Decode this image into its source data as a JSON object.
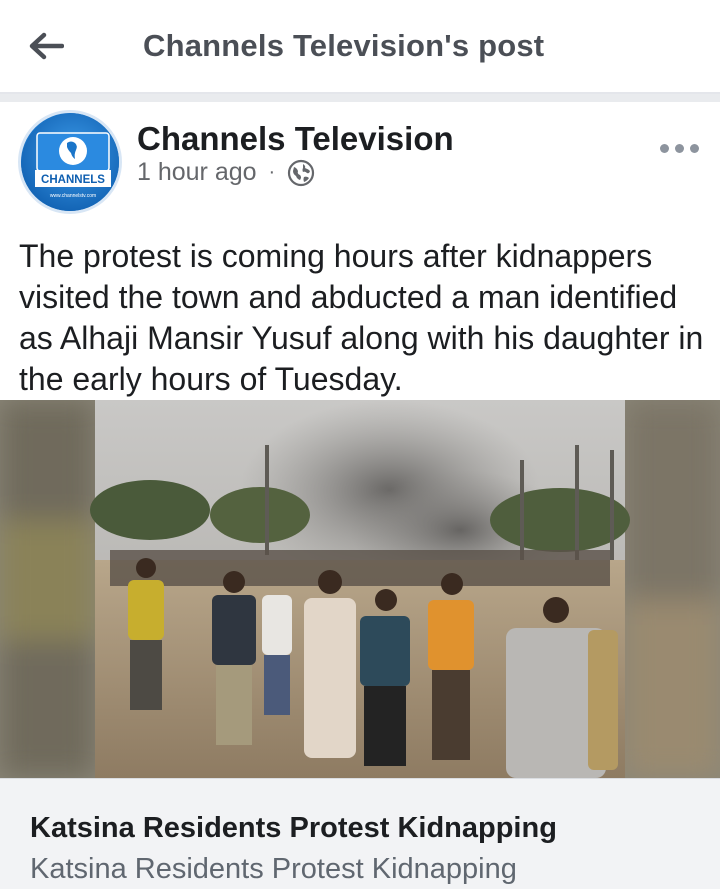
{
  "header": {
    "title": "Channels Television's post",
    "back_icon": "arrow-left-icon"
  },
  "post": {
    "author": "Channels Television",
    "avatar_text": "CHANNELS",
    "avatar_url_text": "www.channelstv.com",
    "time": "1 hour ago",
    "separator": "·",
    "privacy_icon": "globe-icon",
    "more_icon": "more-dots-icon",
    "text": "The protest is coming hours after kidnappers visited the town and abducted a man identified as Alhaji Mansir Yusuf along with his daughter in the early hours of Tuesday."
  },
  "link_preview": {
    "title": "Katsina Residents Protest Kidnapping",
    "description": "Katsina Residents Protest Kidnapping"
  },
  "colors": {
    "brand_blue": "#1a75c9",
    "muted_text": "#65676b",
    "link_bg": "#f2f3f5"
  }
}
